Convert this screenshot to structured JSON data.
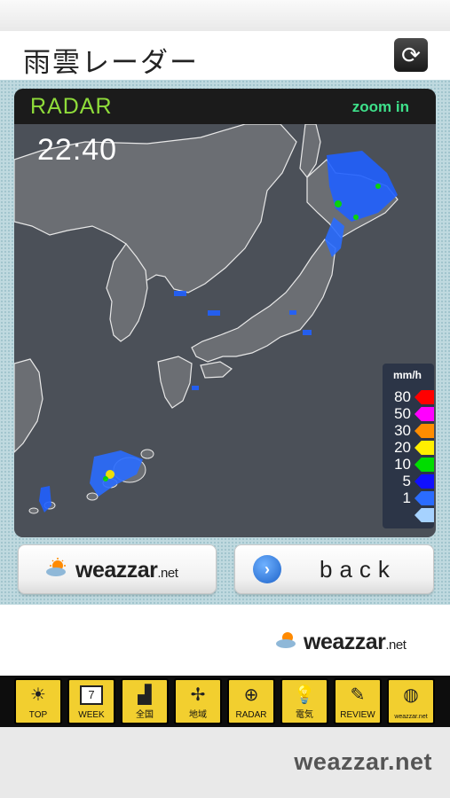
{
  "header": {
    "title": "雨雲レーダー",
    "refresh_icon": "refresh-icon"
  },
  "radar": {
    "label": "RADAR",
    "zoom_label": "zoom in",
    "time": "22:40",
    "legend": {
      "unit": "mm/h",
      "items": [
        {
          "value": "80",
          "color": "#ff0000"
        },
        {
          "value": "50",
          "color": "#ff00ff"
        },
        {
          "value": "30",
          "color": "#ff8c00"
        },
        {
          "value": "20",
          "color": "#ffee00"
        },
        {
          "value": "10",
          "color": "#00dd00"
        },
        {
          "value": "5",
          "color": "#1010ff"
        },
        {
          "value": "1",
          "color": "#2a6cff"
        },
        {
          "value": "",
          "color": "#a6d2ff"
        }
      ]
    }
  },
  "buttons": {
    "weazzar": {
      "brand": "weazzar",
      "suffix": ".net"
    },
    "back": {
      "label": "back"
    }
  },
  "footer_logo": {
    "brand": "weazzar",
    "suffix": ".net"
  },
  "nav": [
    {
      "label": "TOP",
      "icon": "sun-icon"
    },
    {
      "label": "WEEK",
      "icon": "calendar-icon",
      "badge": "7"
    },
    {
      "label": "全国",
      "icon": "bars-icon"
    },
    {
      "label": "地域",
      "icon": "hokkaido-icon"
    },
    {
      "label": "RADAR",
      "icon": "radar-icon"
    },
    {
      "label": "電気",
      "icon": "bulb-icon"
    },
    {
      "label": "REVIEW",
      "icon": "pencil-icon"
    },
    {
      "label": "weazzar.net",
      "icon": "globe-icon"
    }
  ],
  "bottom_logo": "weazzar.net"
}
